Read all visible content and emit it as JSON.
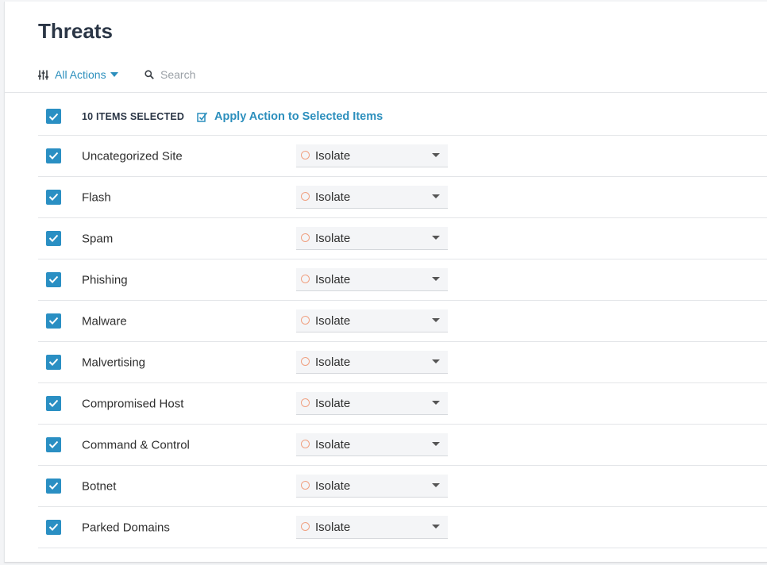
{
  "page": {
    "title": "Threats"
  },
  "toolbar": {
    "filter_label": "All Actions",
    "search_placeholder": "Search"
  },
  "selection": {
    "count_label": "10 ITEMS SELECTED",
    "apply_label": "Apply Action to Selected Items",
    "all_checked": true
  },
  "colors": {
    "accent": "#2c8fbd",
    "checkbox": "#2a8fc3",
    "action_ring": "#f0a080",
    "title": "#2b3646"
  },
  "threats": [
    {
      "name": "Uncategorized Site",
      "action": "Isolate",
      "checked": true
    },
    {
      "name": "Flash",
      "action": "Isolate",
      "checked": true
    },
    {
      "name": "Spam",
      "action": "Isolate",
      "checked": true
    },
    {
      "name": "Phishing",
      "action": "Isolate",
      "checked": true
    },
    {
      "name": "Malware",
      "action": "Isolate",
      "checked": true
    },
    {
      "name": "Malvertising",
      "action": "Isolate",
      "checked": true
    },
    {
      "name": "Compromised Host",
      "action": "Isolate",
      "checked": true
    },
    {
      "name": "Command & Control",
      "action": "Isolate",
      "checked": true
    },
    {
      "name": "Botnet",
      "action": "Isolate",
      "checked": true
    },
    {
      "name": "Parked Domains",
      "action": "Isolate",
      "checked": true
    }
  ]
}
